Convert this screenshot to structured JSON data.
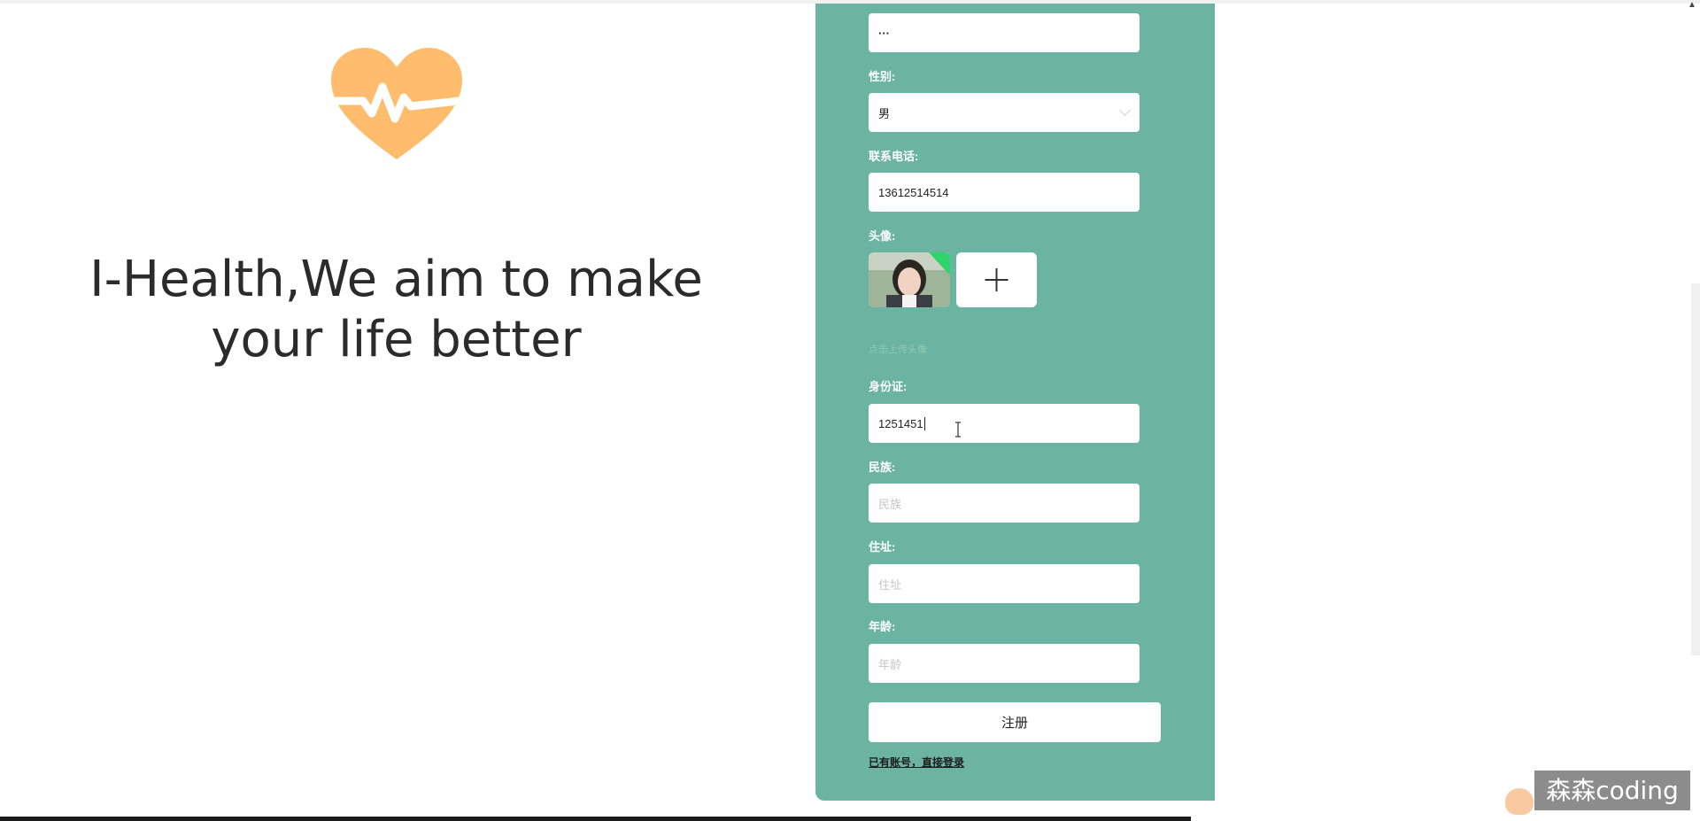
{
  "hero": {
    "slogan_line1": "I-Health,We aim to make",
    "slogan_line2": "your life better",
    "logo_icon": "heart-pulse-icon",
    "logo_color": "#ffbc6c"
  },
  "form": {
    "panel_color": "#6ab4a1",
    "password_value": "···",
    "gender": {
      "label": "性别:",
      "value": "男"
    },
    "phone": {
      "label": "联系电话:",
      "value": "13612514514"
    },
    "avatar": {
      "label": "头像:",
      "upload_icon": "plus-icon",
      "tip": "点击上传头像"
    },
    "id_card": {
      "label": "身份证:",
      "value": "1251451"
    },
    "ethnicity": {
      "label": "民族:",
      "placeholder": "民族"
    },
    "address": {
      "label": "住址:",
      "placeholder": "住址"
    },
    "age": {
      "label": "年龄:",
      "placeholder": "年龄"
    },
    "submit_label": "注册",
    "login_link": "已有账号，直接登录"
  },
  "watermark": "森森coding"
}
